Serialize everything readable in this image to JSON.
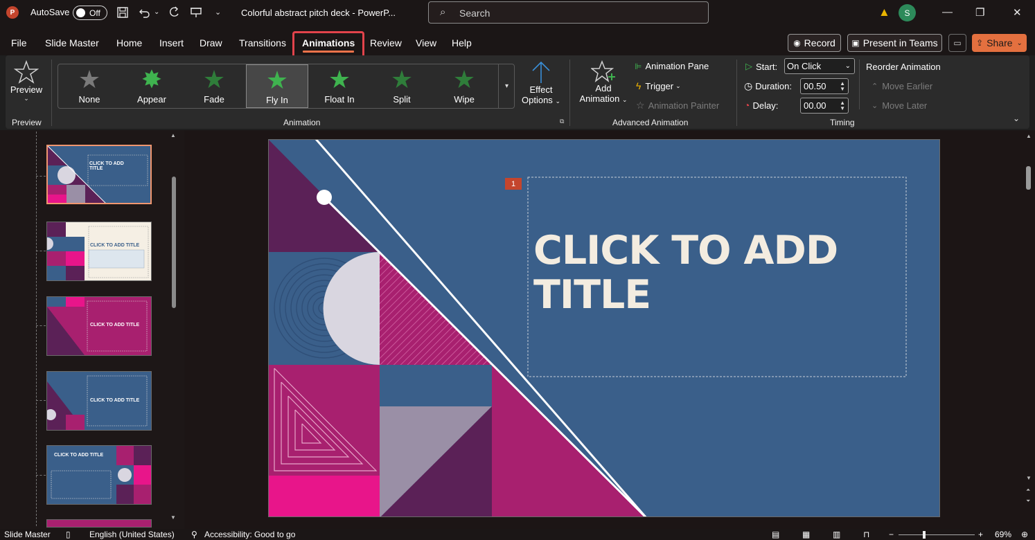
{
  "app": {
    "logo_letter": "P",
    "autosave_label": "AutoSave",
    "autosave_state": "Off",
    "doc_title": "Colorful abstract pitch deck  -  PowerP...",
    "search_placeholder": "Search",
    "avatar_initial": "S"
  },
  "menu": {
    "tabs": [
      "File",
      "Slide Master",
      "Home",
      "Insert",
      "Draw",
      "Transitions",
      "Animations",
      "Review",
      "View",
      "Help"
    ],
    "active_tab": "Animations",
    "record_label": "Record",
    "teams_label": "Present in Teams",
    "share_label": "Share"
  },
  "ribbon": {
    "preview": {
      "label": "Preview",
      "group": "Preview"
    },
    "animation_group": "Animation",
    "gallery": [
      {
        "label": "None",
        "color": "#7a7a7a"
      },
      {
        "label": "Appear",
        "color": "#3fb34f"
      },
      {
        "label": "Fade",
        "color": "#2f7d3a"
      },
      {
        "label": "Fly In",
        "color": "#3fb34f"
      },
      {
        "label": "Float In",
        "color": "#3fb34f"
      },
      {
        "label": "Split",
        "color": "#2f7d3a"
      },
      {
        "label": "Wipe",
        "color": "#2f7d3a"
      }
    ],
    "selected_effect": "Fly In",
    "effect_options": {
      "line1": "Effect",
      "line2": "Options"
    },
    "advanced": {
      "group": "Advanced Animation",
      "add_line1": "Add",
      "add_line2": "Animation",
      "pane": "Animation Pane",
      "trigger": "Trigger",
      "painter": "Animation Painter"
    },
    "timing": {
      "group": "Timing",
      "start_label": "Start:",
      "start_value": "On Click",
      "duration_label": "Duration:",
      "duration_value": "00.50",
      "delay_label": "Delay:",
      "delay_value": "00.00",
      "reorder": "Reorder Animation",
      "move_earlier": "Move Earlier",
      "move_later": "Move Later"
    }
  },
  "thumbnails": [
    {
      "title": "CLICK TO ADD TITLE",
      "bg": "#3a5f8a"
    },
    {
      "title": "CLICK TO ADD TITLE",
      "bg": "#f5efe4"
    },
    {
      "title": "CLICK TO ADD TITLE",
      "bg": "#a8206f"
    },
    {
      "title": "CLICK TO ADD TITLE",
      "bg": "#3a5f8a"
    },
    {
      "title": "CLICK TO ADD TITLE",
      "bg": "#3a5f8a"
    }
  ],
  "slide": {
    "title": "CLICK TO ADD TITLE",
    "animation_badge": "1",
    "colors": {
      "blue": "#3a5f8a",
      "purple": "#5b2157",
      "magenta": "#a8206f",
      "hotpink": "#e8158a",
      "grey": "#9a8fa6",
      "pale": "#d9d6e0"
    }
  },
  "status": {
    "view": "Slide Master",
    "language": "English (United States)",
    "accessibility": "Accessibility: Good to go",
    "zoom": "69%"
  }
}
